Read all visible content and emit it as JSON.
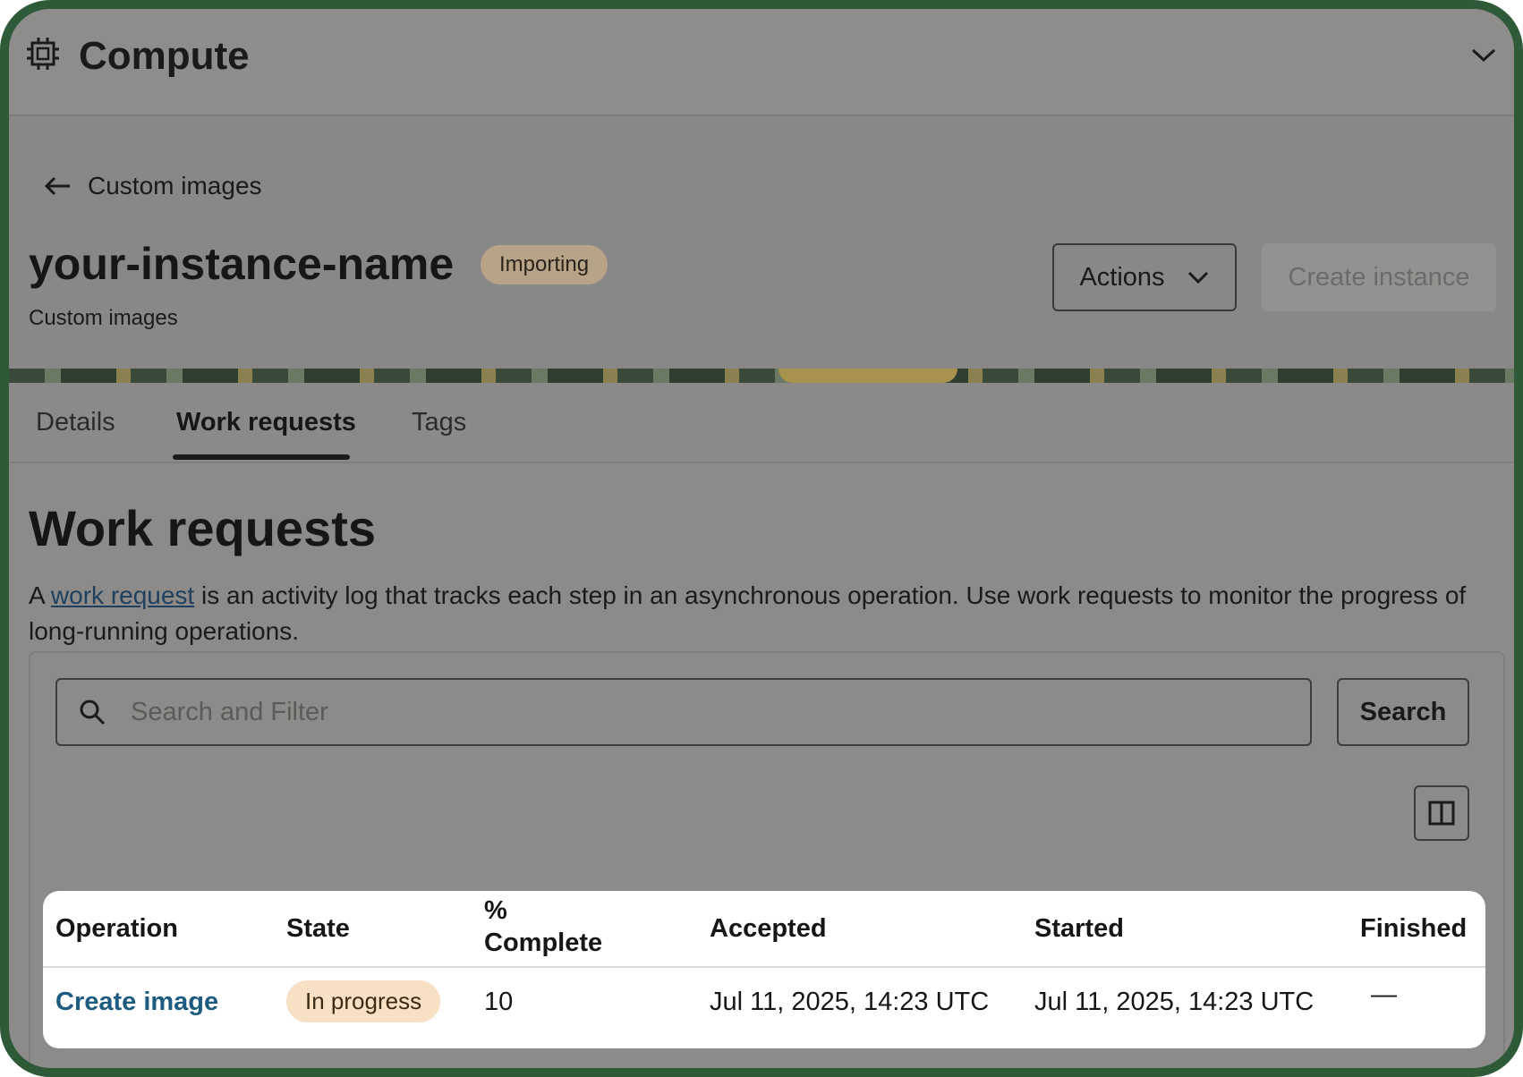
{
  "topbar": {
    "title": "Compute",
    "icon": "chip-icon"
  },
  "header": {
    "back_label": "Custom images",
    "title": "your-instance-name",
    "status": "Importing",
    "subtitle": "Custom images",
    "actions_label": "Actions",
    "create_label": "Create instance"
  },
  "tabs": [
    {
      "label": "Details"
    },
    {
      "label": "Work requests",
      "active": true
    },
    {
      "label": "Tags"
    }
  ],
  "section": {
    "title": "Work requests",
    "desc_prefix": "A ",
    "desc_link": "work request",
    "desc_suffix": " is an activity log that tracks each step in an asynchronous operation. Use work requests to monitor the progress of long-running operations."
  },
  "search": {
    "placeholder": "Search and Filter",
    "button_label": "Search"
  },
  "table": {
    "headers": {
      "operation": "Operation",
      "state": "State",
      "complete_line1": "%",
      "complete_line2": "Complete",
      "accepted": "Accepted",
      "started": "Started",
      "finished": "Finished"
    },
    "rows": [
      {
        "operation": "Create image",
        "state": "In progress",
        "complete": "10",
        "accepted": "Jul 11, 2025, 14:23 UTC",
        "started": "Jul 11, 2025, 14:23 UTC",
        "finished": "—"
      }
    ]
  },
  "colors": {
    "frame": "#2f5a38",
    "link": "#1d5b80",
    "importing_badge": "#b7a387",
    "progress_badge": "#f7e0c4"
  }
}
